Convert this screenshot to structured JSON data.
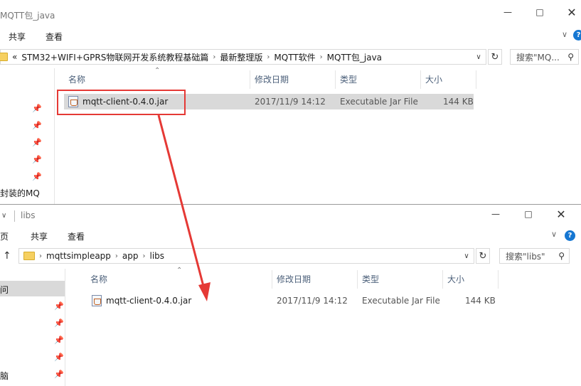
{
  "window1": {
    "title": "MQTT包_java",
    "ribbon": {
      "tab_share": "共享",
      "tab_view": "查看"
    },
    "address": {
      "prefix": "«",
      "crumbs": [
        "STM32+WIFI+GPRS物联网开发系统教程基础篇",
        "最新整理版",
        "MQTT软件",
        "MQTT包_java"
      ]
    },
    "search_placeholder": "搜索\"MQ...",
    "nav_text": "封装的MQ",
    "columns": {
      "name": "名称",
      "date": "修改日期",
      "type": "类型",
      "size": "大小"
    },
    "file": {
      "name": "mqtt-client-0.4.0.jar",
      "date": "2017/11/9 14:12",
      "type": "Executable Jar File",
      "size": "144 KB"
    }
  },
  "window2": {
    "title": "libs",
    "ribbon": {
      "tab_home": "页",
      "tab_share": "共享",
      "tab_view": "查看"
    },
    "address": {
      "crumbs": [
        "mqttsimpleapp",
        "app",
        "libs"
      ]
    },
    "search_placeholder": "搜索\"libs\"",
    "nav_items": [
      "问",
      "脑"
    ],
    "columns": {
      "name": "名称",
      "date": "修改日期",
      "type": "类型",
      "size": "大小"
    },
    "file": {
      "name": "mqtt-client-0.4.0.jar",
      "date": "2017/11/9 14:12",
      "type": "Executable Jar File",
      "size": "144 KB"
    }
  },
  "colors": {
    "highlight": "#e53935",
    "selected_row": "#d9d9d9",
    "help_blue": "#1677d2",
    "folder_yellow": "#f6d061"
  },
  "icons": [
    "minimize-icon",
    "maximize-icon",
    "close-icon",
    "help-icon",
    "chevron-down-icon",
    "refresh-icon",
    "search-icon",
    "pin-icon",
    "jar-file-icon",
    "folder-icon",
    "up-arrow-icon",
    "sort-caret-icon"
  ]
}
